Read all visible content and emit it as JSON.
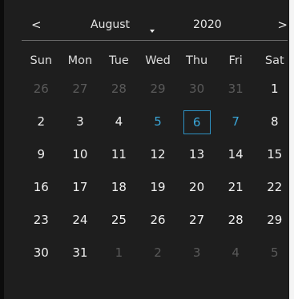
{
  "header": {
    "prev_label": "<",
    "next_label": ">",
    "month": "August",
    "year": "2020"
  },
  "weekdays": [
    "Sun",
    "Mon",
    "Tue",
    "Wed",
    "Thu",
    "Fri",
    "Sat"
  ],
  "weeks": [
    [
      {
        "d": "26",
        "s": "muted"
      },
      {
        "d": "27",
        "s": "muted"
      },
      {
        "d": "28",
        "s": "muted"
      },
      {
        "d": "29",
        "s": "muted"
      },
      {
        "d": "30",
        "s": "muted"
      },
      {
        "d": "31",
        "s": "muted"
      },
      {
        "d": "1",
        "s": ""
      }
    ],
    [
      {
        "d": "2",
        "s": ""
      },
      {
        "d": "3",
        "s": ""
      },
      {
        "d": "4",
        "s": ""
      },
      {
        "d": "5",
        "s": "highlight"
      },
      {
        "d": "6",
        "s": "selected"
      },
      {
        "d": "7",
        "s": "highlight"
      },
      {
        "d": "8",
        "s": ""
      }
    ],
    [
      {
        "d": "9",
        "s": ""
      },
      {
        "d": "10",
        "s": ""
      },
      {
        "d": "11",
        "s": ""
      },
      {
        "d": "12",
        "s": ""
      },
      {
        "d": "13",
        "s": ""
      },
      {
        "d": "14",
        "s": ""
      },
      {
        "d": "15",
        "s": ""
      }
    ],
    [
      {
        "d": "16",
        "s": ""
      },
      {
        "d": "17",
        "s": ""
      },
      {
        "d": "18",
        "s": ""
      },
      {
        "d": "19",
        "s": ""
      },
      {
        "d": "20",
        "s": ""
      },
      {
        "d": "21",
        "s": ""
      },
      {
        "d": "22",
        "s": ""
      }
    ],
    [
      {
        "d": "23",
        "s": ""
      },
      {
        "d": "24",
        "s": ""
      },
      {
        "d": "25",
        "s": ""
      },
      {
        "d": "26",
        "s": ""
      },
      {
        "d": "27",
        "s": ""
      },
      {
        "d": "28",
        "s": ""
      },
      {
        "d": "29",
        "s": ""
      }
    ],
    [
      {
        "d": "30",
        "s": ""
      },
      {
        "d": "31",
        "s": ""
      },
      {
        "d": "1",
        "s": "muted"
      },
      {
        "d": "2",
        "s": "muted"
      },
      {
        "d": "3",
        "s": "muted"
      },
      {
        "d": "4",
        "s": "muted"
      },
      {
        "d": "5",
        "s": "muted"
      }
    ]
  ],
  "colors": {
    "background": "#1e1e1e",
    "accent": "#3aa6d8",
    "muted_text": "#5a5a5a",
    "text": "#f0f0f0"
  }
}
